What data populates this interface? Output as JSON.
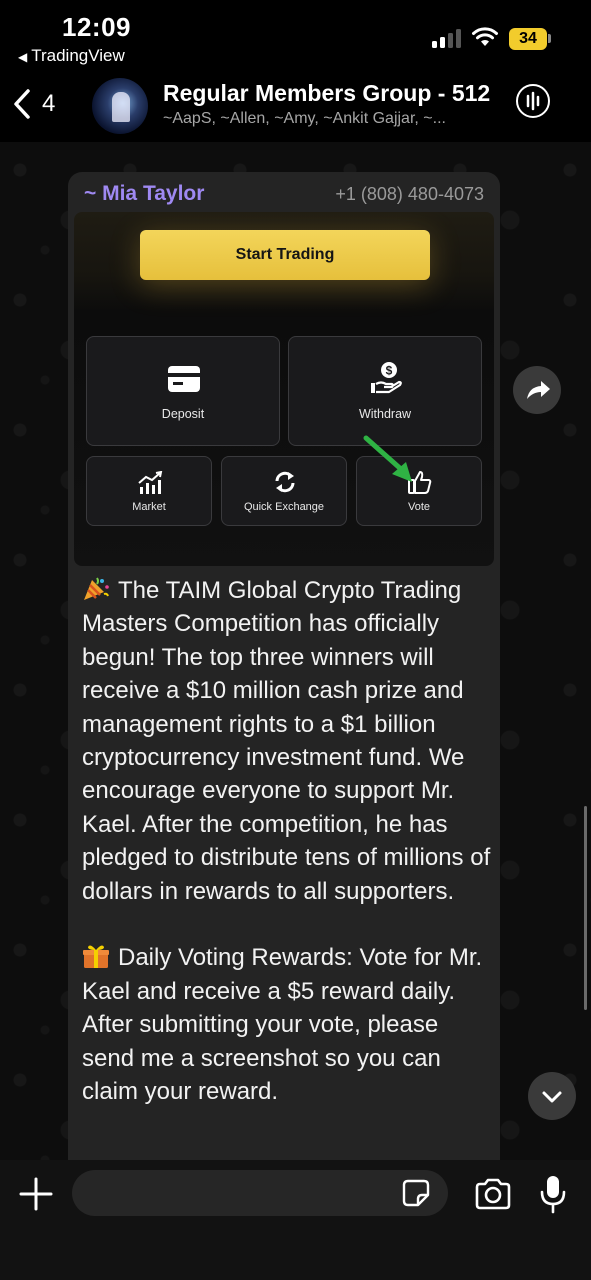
{
  "status_bar": {
    "time": "12:09",
    "back_app": "TradingView",
    "battery": "34",
    "battery_color": "#f2cc2c"
  },
  "header": {
    "back_count": "4",
    "title": "Regular Members Group - 512",
    "members": "~AapS, ~Allen, ~Amy, ~Ankit Gajjar, ~..."
  },
  "message": {
    "sender": "~ Mia Taylor",
    "sender_color": "#9f89f2",
    "phone": "+1 (808) 480-4073",
    "image": {
      "start_button": "Start Trading",
      "tiles": [
        {
          "label": "Deposit",
          "icon": "card-icon"
        },
        {
          "label": "Withdraw",
          "icon": "dollar-hand-icon"
        },
        {
          "label": "Market",
          "icon": "chart-icon"
        },
        {
          "label": "Quick Exchange",
          "icon": "exchange-icon"
        },
        {
          "label": "Vote",
          "icon": "thumbs-up-icon"
        }
      ],
      "annotation": "green-arrow-icon"
    },
    "paragraph1_emoji": "party-popper-icon",
    "paragraph1": "The TAIM Global Crypto Trading Masters Competition has officially begun! The top three winners will receive a $10 million cash prize and management rights to a $1 billion cryptocurrency investment fund. We encourage everyone to support Mr. Kael. After the competition, he has pledged to distribute tens of millions of dollars in rewards to all supporters.",
    "paragraph2_emoji": "gift-icon",
    "paragraph2": "Daily Voting Rewards: Vote for Mr. Kael and receive a $5 reward daily. After submitting your vote, please send me a screenshot so you can claim your reward."
  },
  "composer": {
    "placeholder": ""
  }
}
